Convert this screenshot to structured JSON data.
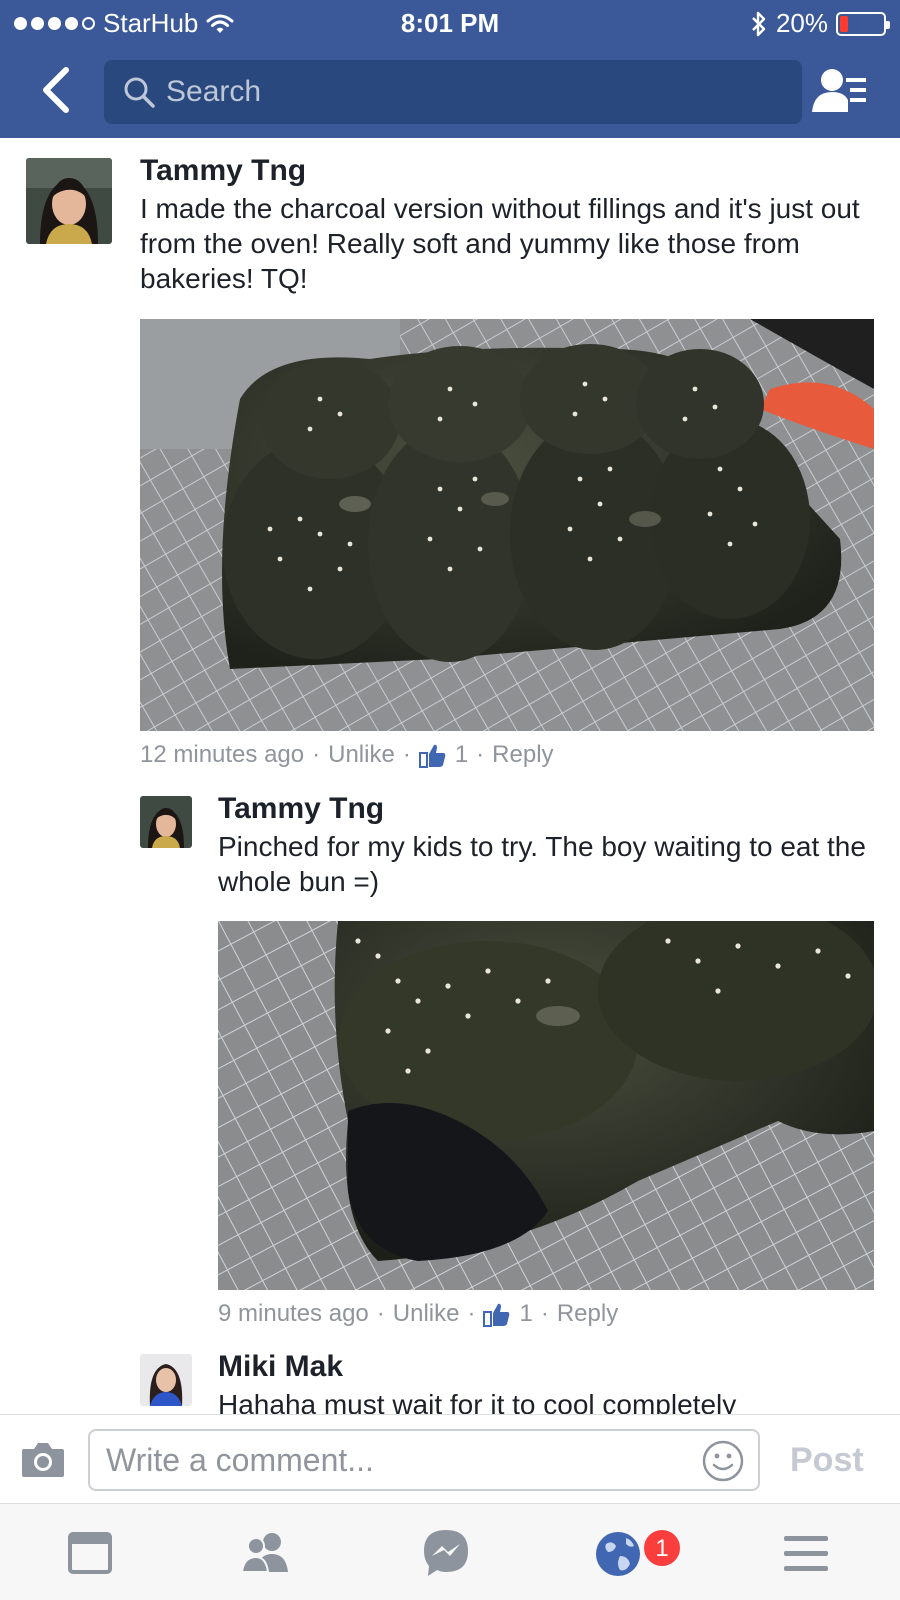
{
  "status_bar": {
    "carrier": "StarHub",
    "time": "8:01 PM",
    "battery": "20%",
    "battery_level": 0.2
  },
  "header": {
    "search_placeholder": "Search"
  },
  "comments": [
    {
      "author": "Tammy Tng",
      "text": "I made the charcoal version without fillings and it's just out from the oven! Really soft and yummy like those from bakeries! TQ!",
      "time": "12 minutes ago",
      "unlike_label": "Unlike",
      "like_count": "1",
      "reply_label": "Reply"
    },
    {
      "author": "Tammy Tng",
      "text": "Pinched for my kids to try. The boy waiting to eat the whole bun =)",
      "time": "9 minutes ago",
      "unlike_label": "Unlike",
      "like_count": "1",
      "reply_label": "Reply"
    },
    {
      "author": "Miki Mak",
      "text": "Hahaha must wait for it to cool completely"
    }
  ],
  "composer": {
    "placeholder": "Write a comment...",
    "post_label": "Post"
  },
  "tabbar": {
    "notifications_badge": "1"
  },
  "colors": {
    "brand": "#3b5998",
    "search_bg": "#29487d",
    "meta": "#90949c",
    "badge": "#fa3e3e",
    "like_blue": "#4267b2"
  }
}
